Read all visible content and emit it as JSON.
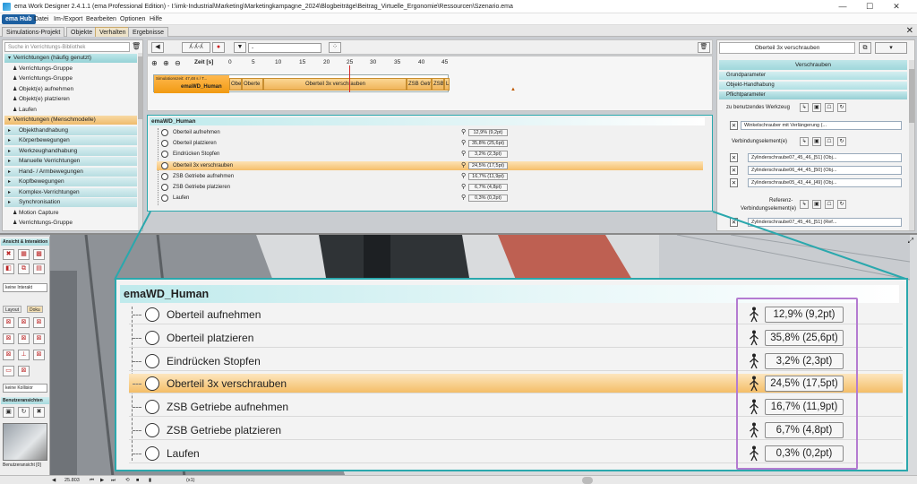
{
  "titlebar": {
    "title": "ema Work Designer 2.4.1.1 (ema Professional Edition) - I:\\imk-Industrial\\Marketing\\Marketingkampagne_2024\\Blogbeiträge\\Beitrag_Virtuelle_Ergonomie\\Ressourcen\\Szenario.ema",
    "minimize": "—",
    "maximize": "☐",
    "close": "✕"
  },
  "menubar": {
    "hub": "ema Hub",
    "items": [
      "Datei",
      "Im-/Export",
      "Bearbeiten",
      "Optionen",
      "Hilfe"
    ]
  },
  "tabs": [
    "Simulations-Projekt",
    "Objekte",
    "Verhalten",
    "Ergebnisse"
  ],
  "tab_close": "✕",
  "library": {
    "search_placeholder": "Suche in Verrichtungs-Bibliothek",
    "rows": [
      {
        "type": "cat",
        "label": "Verrichtungen (häufig genutzt)"
      },
      {
        "type": "item",
        "label": "Verrichtungs-Gruppe"
      },
      {
        "type": "item",
        "label": "Verrichtungs-Gruppe"
      },
      {
        "type": "item",
        "label": "Objekt(e) aufnehmen"
      },
      {
        "type": "item",
        "label": "Objekt(e) platzieren"
      },
      {
        "type": "item",
        "label": "Laufen"
      },
      {
        "type": "cat2",
        "label": "Verrichtungen (Menschmodelle)"
      },
      {
        "type": "sub",
        "label": "Objekthandhabung"
      },
      {
        "type": "sub",
        "label": "Körperbewegungen"
      },
      {
        "type": "sub",
        "label": "Werkzeughandhabung"
      },
      {
        "type": "sub",
        "label": "Manuelle Verrichtungen"
      },
      {
        "type": "sub",
        "label": "Hand- / Armbewegungen"
      },
      {
        "type": "sub",
        "label": "Kopfbewegungen"
      },
      {
        "type": "sub",
        "label": "Komplex-Verrichtungen"
      },
      {
        "type": "sub",
        "label": "Synchronisation"
      },
      {
        "type": "item",
        "label": "Motion Capture"
      },
      {
        "type": "item",
        "label": "Verrichtungs-Gruppe"
      }
    ]
  },
  "toolbar": {
    "select_value": "-",
    "btn_fig": "ʎ·ʎ-ʎ",
    "btn_apple": "●",
    "btn_filter": "▼",
    "btn_dots": "⁘",
    "btn_trash": "🗑"
  },
  "timeline": {
    "label": "Zeit [s]",
    "ticks": [
      "0",
      "5",
      "10",
      "15",
      "20",
      "25",
      "30",
      "35",
      "40",
      "45"
    ],
    "human_name": "emaWD_Human",
    "sim_info": "Simulationszeit: 47,48 s / T...",
    "segments": [
      "Ober",
      "Oberte",
      "Oberteil 3x verschrauben",
      "ZSB Getr",
      "ZSB G",
      "La"
    ]
  },
  "activity_panel": {
    "human": "emaWD_Human",
    "items": [
      {
        "label": "Oberteil aufnehmen",
        "value": "12,9% (9,2pt)",
        "highlight": false
      },
      {
        "label": "Oberteil platzieren",
        "value": "35,8% (25,6pt)",
        "highlight": false
      },
      {
        "label": "Eindrücken Stopfen",
        "value": "3,2% (2,3pt)",
        "highlight": false
      },
      {
        "label": "Oberteil 3x verschrauben",
        "value": "24,5% (17,5pt)",
        "highlight": true
      },
      {
        "label": "ZSB Getriebe aufnehmen",
        "value": "16,7% (11,9pt)",
        "highlight": false
      },
      {
        "label": "ZSB Getriebe platzieren",
        "value": "6,7% (4,8pt)",
        "highlight": false
      },
      {
        "label": "Laufen",
        "value": "0,3% (0,2pt)",
        "highlight": false
      }
    ]
  },
  "properties": {
    "title": "Oberteil 3x verschrauben",
    "header": "Verschrauben",
    "sections": [
      "Grundparameter",
      "Objekt-Handhabung",
      "Pflichtparameter"
    ],
    "tool_label": "zu benutzendes Werkzeug",
    "tool_value": "Winkelschrauber mit Verlängerung (...",
    "conn_label": "Verbindungselement(e)",
    "conn_values": [
      "Zylinderschraube07_45_46_[51] (Obj...",
      "Zylinderschraube06_44_45_[50] (Obj...",
      "Zylinderschraube05_43_44_[49] (Obj..."
    ],
    "ref_label": "Referenz-",
    "ref_label2": "Verbindungselement(e)",
    "ref_value": "Zylinderschraube07_45_46_[51] (Ref..."
  },
  "left_tools": {
    "section1": "Ansicht & Interaktion",
    "interact_select": "keine Interakt",
    "layout_tab": "Layout",
    "doku_tab": "Doku",
    "collision_select": "keine Kollisior",
    "user_views": "Benutzeransichten",
    "view_caption": "Benutzeransicht [0]"
  },
  "status": {
    "time": "25.803",
    "speed": "(x1)"
  }
}
